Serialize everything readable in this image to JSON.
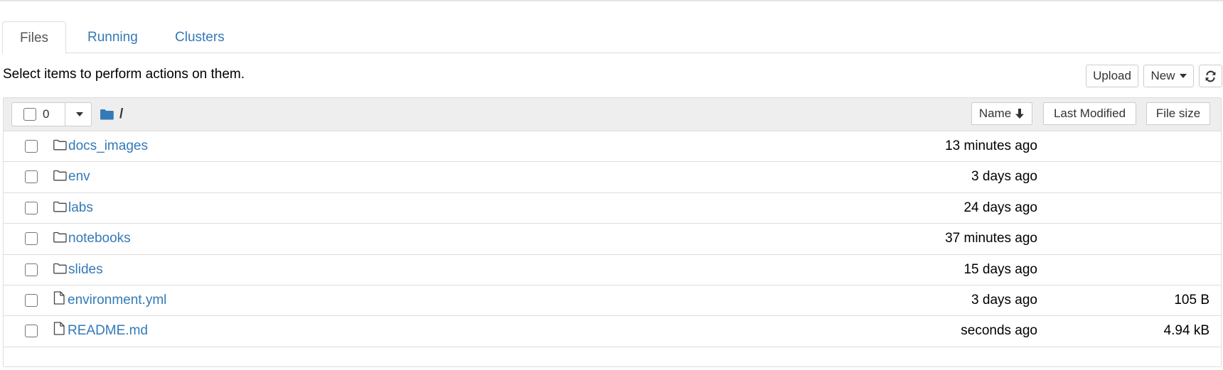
{
  "tabs": [
    {
      "label": "Files"
    },
    {
      "label": "Running"
    },
    {
      "label": "Clusters"
    }
  ],
  "hint": "Select items to perform actions on them.",
  "toolbar": {
    "upload_label": "Upload",
    "new_label": "New"
  },
  "header": {
    "selected_count": "0",
    "breadcrumb": "/",
    "sort_name_label": "Name",
    "sort_modified_label": "Last Modified",
    "sort_size_label": "File size"
  },
  "rows": [
    {
      "name": "docs_images",
      "type": "folder",
      "modified": "13 minutes ago",
      "size": ""
    },
    {
      "name": "env",
      "type": "folder",
      "modified": "3 days ago",
      "size": ""
    },
    {
      "name": "labs",
      "type": "folder",
      "modified": "24 days ago",
      "size": ""
    },
    {
      "name": "notebooks",
      "type": "folder",
      "modified": "37 minutes ago",
      "size": ""
    },
    {
      "name": "slides",
      "type": "folder",
      "modified": "15 days ago",
      "size": ""
    },
    {
      "name": "environment.yml",
      "type": "file",
      "modified": "3 days ago",
      "size": "105 B"
    },
    {
      "name": "README.md",
      "type": "file",
      "modified": "seconds ago",
      "size": "4.94 kB"
    }
  ],
  "icons": {
    "folder": "folder-icon",
    "file": "file-icon",
    "refresh": "refresh-icon",
    "sort": "arrow-down-icon"
  },
  "colors": {
    "link": "#337ab7",
    "header_bg": "#eeeeee",
    "border": "#dddddd"
  }
}
